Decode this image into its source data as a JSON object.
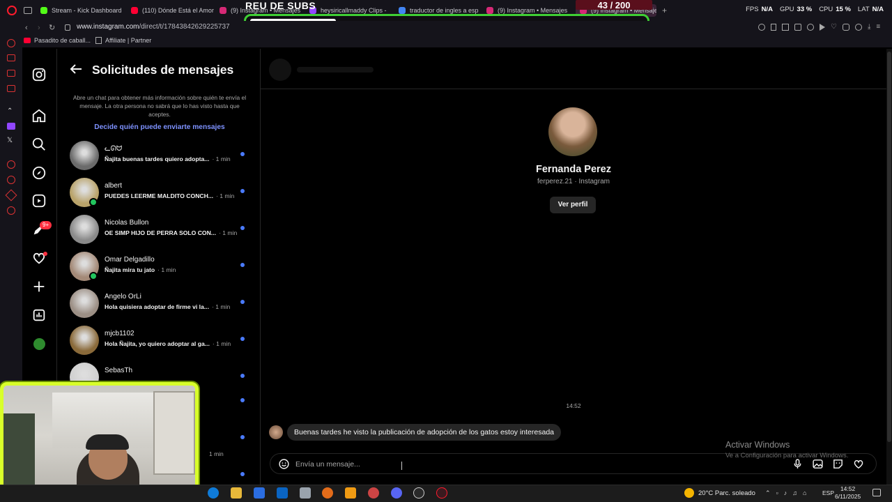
{
  "browser": {
    "tabs": [
      {
        "label": "Stream - Kick Dashboard",
        "color": "#53fc18"
      },
      {
        "label": "(110) Dónde Está el Amor",
        "color": "#ff0033"
      },
      {
        "label": "(9) Instagram • Mensajes",
        "color": "#d62976"
      },
      {
        "label": "heysiricallmaddy Clips -",
        "color": "#9146ff"
      },
      {
        "label": "traductor de ingles a esp",
        "color": "#4285f4"
      },
      {
        "label": "(9) Instagram • Mensajes",
        "color": "#d62976"
      },
      {
        "label": "(9) Instagram • Mensajes",
        "color": "#d62976"
      }
    ],
    "new_tab": "+",
    "stats": [
      {
        "name": "FPS",
        "value": "N/A"
      },
      {
        "name": "GPU",
        "value": "33 %"
      },
      {
        "name": "CPU",
        "value": "15 %"
      },
      {
        "name": "LAT",
        "value": "N/A"
      }
    ],
    "url_host": "www.instagram.com",
    "url_path": "/direct/t/17843842629225737",
    "bookmarks": [
      "Pasadito de caball...",
      "Affiliate | Partner"
    ]
  },
  "overlay": {
    "title": "REU DE SUBS",
    "counter": "43 / 200",
    "progress": 0.215
  },
  "requests": {
    "title": "Solicitudes de mensajes",
    "description": "Abre un chat para obtener más información sobre quién te envía el mensaje. La otra persona no sabrá que lo has visto hasta que aceptes.",
    "link": "Decide quién puede enviarte mensajes",
    "items": [
      {
        "name": "ᓚᘏᗢ",
        "message": "Ñajita buenas tardes quiero adopta...",
        "time": "· 1 min",
        "online": false,
        "avatar": "#6b6b6b"
      },
      {
        "name": "albert",
        "message": "PUEDES LEERME MALDITO CONCH...",
        "time": "· 1 min",
        "online": true,
        "avatar": "#b9a36a"
      },
      {
        "name": "Nicolas Bullon",
        "message": "OE SIMP HIJO DE PERRA SOLO CON...",
        "time": "· 1 min",
        "online": false,
        "avatar": "#8a8a8a"
      },
      {
        "name": "Omar Delgadillo",
        "message": "Ñajita mira tu jato",
        "time": "· 1 min",
        "online": true,
        "avatar": "#a48a78"
      },
      {
        "name": "Angelo OrLi",
        "message": "Hola quisiera adoptar de firme vi la...",
        "time": "· 1 min",
        "online": false,
        "avatar": "#9c8f85"
      },
      {
        "name": "mjcb1102",
        "message": "Hola Ñajita, yo quiero adoptar al ga...",
        "time": "· 1 min",
        "online": false,
        "avatar": "#8a6a3a"
      },
      {
        "name": "SebasTh",
        "message": "",
        "time": "",
        "online": false,
        "avatar": "#d0d0d0"
      }
    ]
  },
  "chat": {
    "profile_name": "Fernanda Perez",
    "profile_sub": "ferperez.21 · Instagram",
    "profile_button": "Ver perfil",
    "timestamp": "14:52",
    "message": "Buenas tardes he visto la publicación de adopción de los gatos estoy interesada",
    "composer_placeholder": "Envía un mensaje..."
  },
  "windows_watermark": {
    "title": "Activar Windows",
    "subtitle": "Ve a Configuración para activar Windows."
  },
  "webcam_list_time": "1 min",
  "nav_badge": "9+",
  "taskbar": {
    "weather": "20°C  Parc. soleado",
    "language": "ESP",
    "time": "14:52",
    "date": "6/11/2025"
  }
}
